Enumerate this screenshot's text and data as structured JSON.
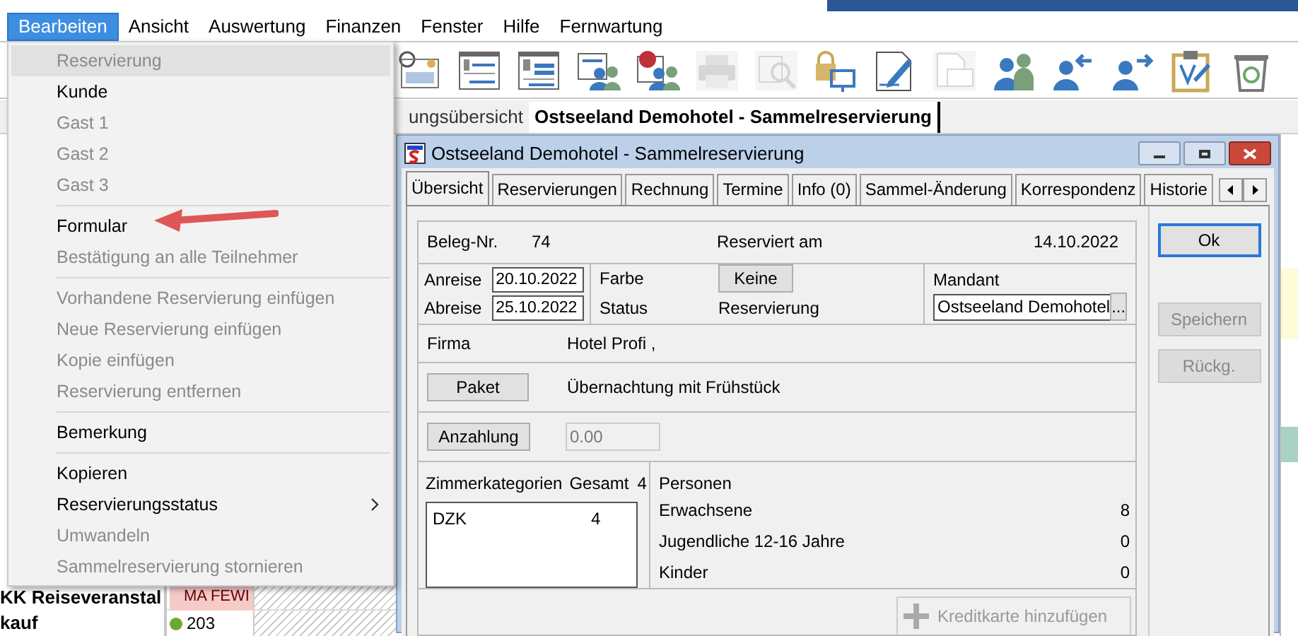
{
  "menu_bar": [
    {
      "label": "Bearbeiten",
      "selected": true
    },
    {
      "label": "Ansicht",
      "selected": false
    },
    {
      "label": "Auswertung",
      "selected": false
    },
    {
      "label": "Finanzen",
      "selected": false
    },
    {
      "label": "Fenster",
      "selected": false
    },
    {
      "label": "Hilfe",
      "selected": false
    },
    {
      "label": "Fernwartung",
      "selected": false
    }
  ],
  "toolbar": [
    {
      "kind": "spa",
      "disabled": false
    },
    {
      "kind": "form-e",
      "disabled": false
    },
    {
      "kind": "form-g",
      "disabled": false
    },
    {
      "kind": "people-doc",
      "disabled": false
    },
    {
      "kind": "help-people",
      "disabled": false
    },
    {
      "kind": "printer",
      "disabled": true
    },
    {
      "kind": "preview",
      "disabled": true
    },
    {
      "kind": "lock",
      "disabled": false
    },
    {
      "kind": "edit",
      "disabled": false
    },
    {
      "kind": "mail",
      "disabled": true
    },
    {
      "kind": "people",
      "disabled": false
    },
    {
      "kind": "person-in",
      "disabled": false
    },
    {
      "kind": "person-out",
      "disabled": false
    },
    {
      "kind": "clipboard",
      "disabled": false
    },
    {
      "kind": "recycle",
      "disabled": false
    }
  ],
  "document_tabs": [
    {
      "label": "ungsübersicht",
      "selected": false
    },
    {
      "label": "Ostseeland Demohotel - Sammelreservierung",
      "selected": true
    }
  ],
  "left_list": [
    "KK Reiseveranstal",
    "kauf"
  ],
  "grid": [
    {
      "label": "MA FEWI",
      "kind": "booking",
      "color": "#f7caca"
    },
    {
      "label": "203",
      "kind": "room",
      "color": "#6aaa2a"
    }
  ],
  "dropdown": [
    {
      "kind": "item",
      "label": "Reservierung",
      "disabled": true,
      "highlighted": true
    },
    {
      "kind": "item",
      "label": "Kunde",
      "disabled": false,
      "highlighted": false
    },
    {
      "kind": "item",
      "label": "Gast 1",
      "disabled": true,
      "highlighted": false
    },
    {
      "kind": "item",
      "label": "Gast 2",
      "disabled": true,
      "highlighted": false
    },
    {
      "kind": "item",
      "label": "Gast 3",
      "disabled": true,
      "highlighted": false
    },
    {
      "kind": "separator"
    },
    {
      "kind": "item",
      "label": "Formular",
      "disabled": false,
      "highlighted": false,
      "annotated": true
    },
    {
      "kind": "item",
      "label": "Bestätigung an alle Teilnehmer",
      "disabled": true,
      "highlighted": false
    },
    {
      "kind": "separator"
    },
    {
      "kind": "item",
      "label": "Vorhandene Reservierung einfügen",
      "disabled": true,
      "highlighted": false
    },
    {
      "kind": "item",
      "label": "Neue Reservierung einfügen",
      "disabled": true,
      "highlighted": false
    },
    {
      "kind": "item",
      "label": "Kopie einfügen",
      "disabled": true,
      "highlighted": false
    },
    {
      "kind": "item",
      "label": "Reservierung entfernen",
      "disabled": true,
      "highlighted": false
    },
    {
      "kind": "separator"
    },
    {
      "kind": "item",
      "label": "Bemerkung",
      "disabled": false,
      "highlighted": false
    },
    {
      "kind": "separator"
    },
    {
      "kind": "item",
      "label": "Kopieren",
      "disabled": false,
      "highlighted": false
    },
    {
      "kind": "item",
      "label": "Reservierungsstatus",
      "disabled": false,
      "highlighted": false,
      "submenu": true
    },
    {
      "kind": "item",
      "label": "Umwandeln",
      "disabled": true,
      "highlighted": false
    },
    {
      "kind": "item",
      "label": "Sammelreservierung stornieren",
      "disabled": true,
      "highlighted": false
    }
  ],
  "dialog": {
    "title": "Ostseeland Demohotel - Sammelreservierung",
    "tabs": [
      {
        "label": "Übersicht",
        "selected": true
      },
      {
        "label": "Reservierungen",
        "selected": false
      },
      {
        "label": "Rechnung",
        "selected": false
      },
      {
        "label": "Termine",
        "selected": false
      },
      {
        "label": "Info (0)",
        "selected": false
      },
      {
        "label": "Sammel-Änderung",
        "selected": false
      },
      {
        "label": "Korrespondenz",
        "selected": false
      },
      {
        "label": "Historie",
        "selected": false
      }
    ],
    "beleg_label": "Beleg-Nr.",
    "beleg_value": "74",
    "reserviert_label": "Reserviert am",
    "reserviert_value": "14.10.2022",
    "anreise_label": "Anreise",
    "anreise_value": "20.10.2022",
    "abreise_label": "Abreise",
    "abreise_value": "25.10.2022",
    "farbe_label": "Farbe",
    "farbe_button": "Keine",
    "status_label": "Status",
    "status_value": "Reservierung",
    "mandant_label": "Mandant",
    "mandant_value": "Ostseeland Demohotel",
    "mandant_button": "...",
    "firma_label": "Firma",
    "firma_value": "Hotel Profi ,",
    "paket_button": "Paket",
    "paket_value": "Übernachtung mit Frühstück",
    "anzahlung_button": "Anzahlung",
    "anzahlung_value": "0.00",
    "zimmer_label": "Zimmerkategorien",
    "gesamt_label": "Gesamt",
    "gesamt_value": "4",
    "zimmer_rows": [
      {
        "name": "DZK",
        "count": "4"
      }
    ],
    "personen_label": "Personen",
    "personen": [
      {
        "label": "Erwachsene",
        "value": "8"
      },
      {
        "label": "Jugendliche 12-16 Jahre",
        "value": "0"
      },
      {
        "label": "Kinder",
        "value": "0"
      }
    ],
    "kreditkarte_button": "Kreditkarte hinzufügen",
    "buttons": [
      {
        "label": "Ok",
        "disabled": false,
        "default": true
      },
      {
        "label": "Speichern",
        "disabled": true,
        "default": false
      },
      {
        "label": "Rückg.",
        "disabled": true,
        "default": false
      }
    ]
  }
}
